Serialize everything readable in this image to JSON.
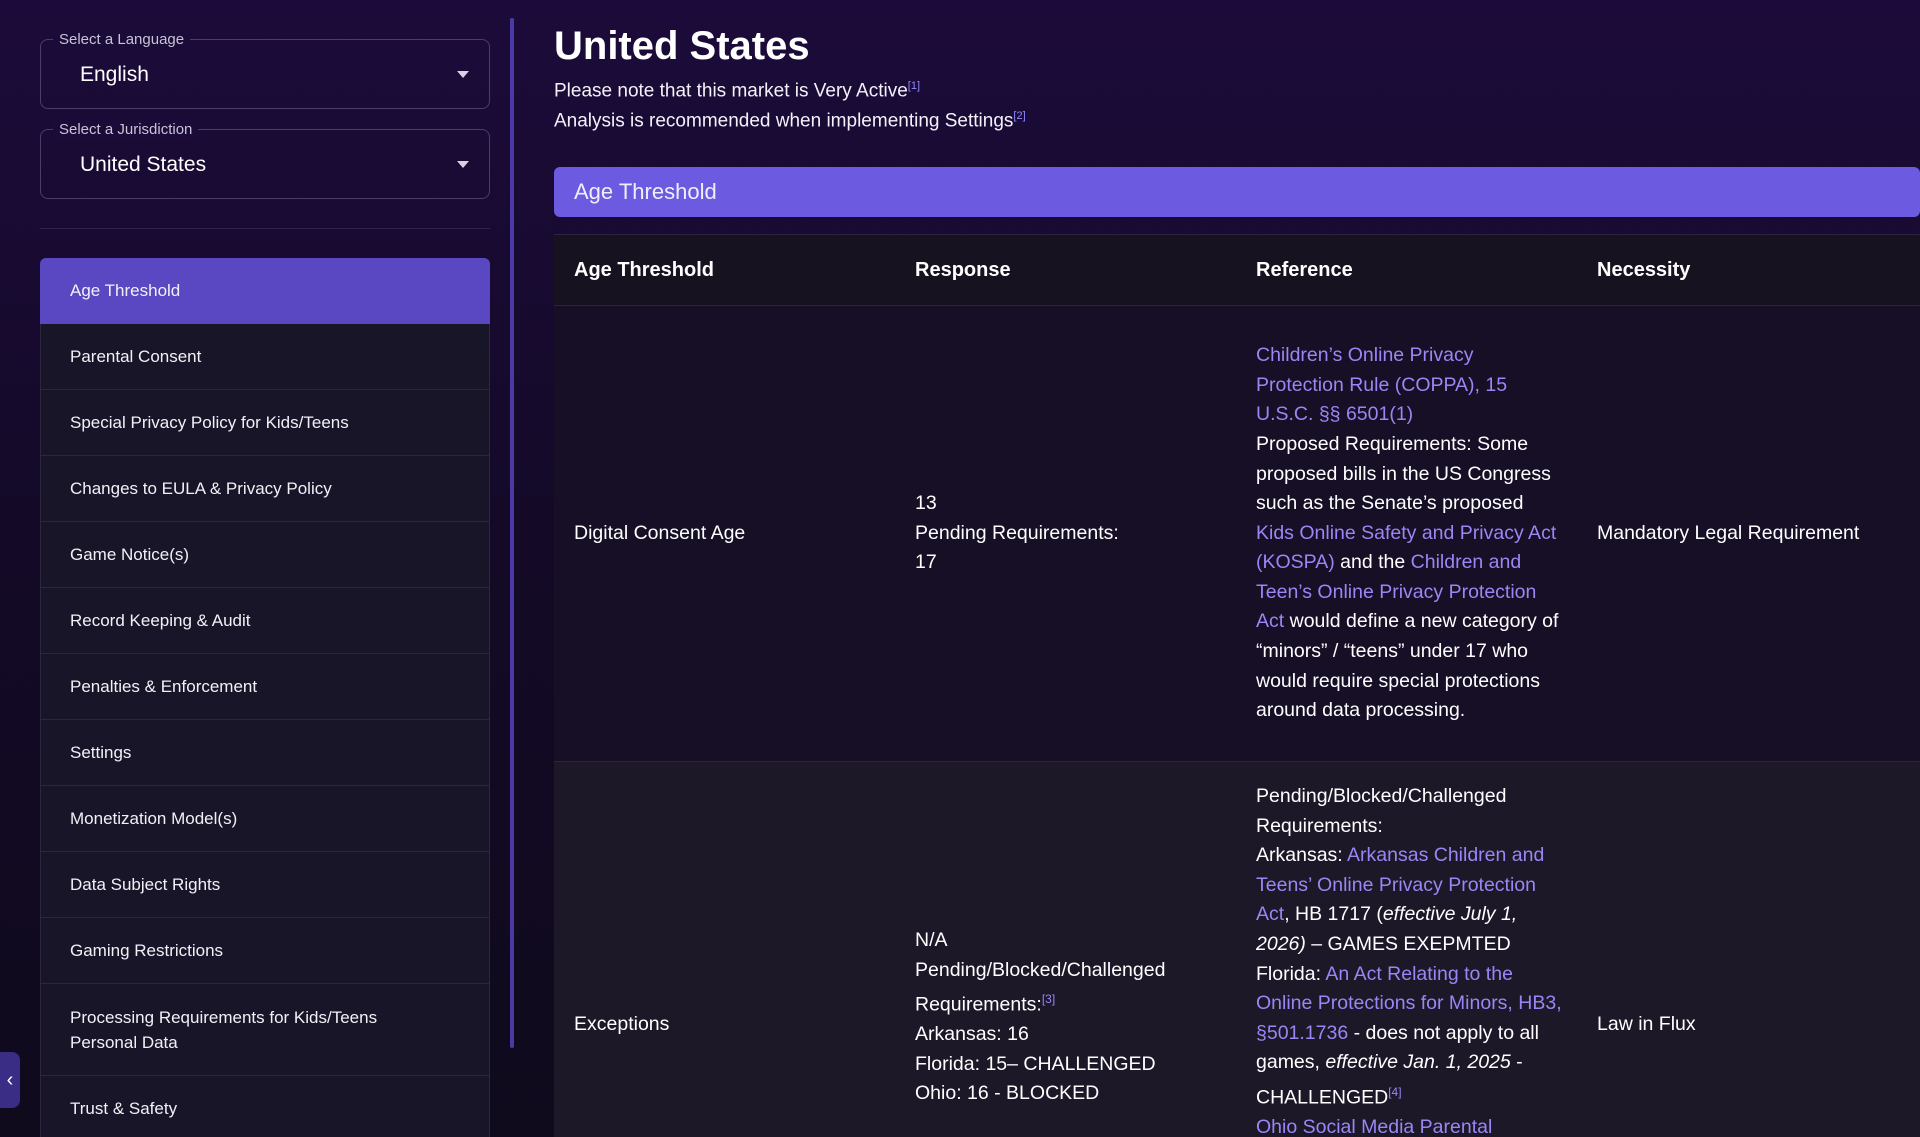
{
  "sidebar": {
    "language": {
      "legend": "Select a Language",
      "value": "English"
    },
    "jurisdiction": {
      "legend": "Select a Jurisdiction",
      "value": "United States"
    },
    "items": [
      {
        "label": "Age Threshold",
        "active": true
      },
      {
        "label": "Parental Consent"
      },
      {
        "label": "Special Privacy Policy for Kids/Teens"
      },
      {
        "label": "Changes to EULA & Privacy Policy"
      },
      {
        "label": "Game Notice(s)"
      },
      {
        "label": "Record Keeping & Audit"
      },
      {
        "label": "Penalties & Enforcement"
      },
      {
        "label": "Settings"
      },
      {
        "label": "Monetization Model(s)"
      },
      {
        "label": "Data Subject Rights"
      },
      {
        "label": "Gaming Restrictions"
      },
      {
        "label": "Processing Requirements for Kids/Teens Personal Data"
      },
      {
        "label": "Trust & Safety"
      }
    ],
    "collapse_icon": "chevron-left-icon"
  },
  "main": {
    "title": "United States",
    "note1": "Please note that this market is Very Active",
    "note1_ref": "[1]",
    "note2": "Analysis is recommended when implementing Settings",
    "note2_ref": "[2]",
    "section_title": "Age Threshold",
    "table": {
      "headers": [
        "Age Threshold",
        "Response",
        "Reference",
        "Necessity"
      ],
      "rows": [
        {
          "threshold": "Digital Consent Age",
          "response": [
            "13",
            "Pending Requirements:",
            "17"
          ],
          "reference": {
            "link1": "Children’s Online Privacy Protection Rule (COPPA), 15 U.S.C. §§ 6501(1)",
            "text1": "Proposed Requirements:",
            "text2": "Some proposed bills in the US Congress such as the Senate’s proposed",
            "link2": "Kids Online Safety and Privacy Act (KOSPA)",
            "text3": "and the",
            "link3": "Children and Teen’s Online Privacy Protection Act",
            "text4": "would define a new category of “minors” / “teens” under 17 who would require special protections around data processing."
          },
          "necessity": "Mandatory Legal Requirement"
        },
        {
          "threshold": "Exceptions",
          "response": [
            "N/A",
            "Pending/Blocked/Challenged Requirements:",
            "[3]",
            "Arkansas: 16",
            "Florida: 15– CHALLENGED",
            "Ohio: 16 - BLOCKED"
          ],
          "reference": {
            "text1": "Pending/Blocked/Challenged Requirements:",
            "ark_prefix": "Arkansas:",
            "ark_link": "Arkansas Children and Teens’ Online Privacy Protection Act",
            "ark_text": ", HB 1717 (",
            "ark_em": "effective July 1, 2026)",
            "ark_tail": " – GAMES EXEPMTED",
            "fl_prefix": "Florida:",
            "fl_link": "An Act Relating to the Online Protections for Minors, HB3, §501.1736",
            "fl_text": " - does not apply to all games, ",
            "fl_em": "effective Jan. 1, 2025",
            "fl_tail": " - CHALLENGED",
            "fl_ref": "[4]",
            "oh_link": "Ohio Social Media Parental"
          },
          "necessity": "Law in Flux"
        }
      ]
    }
  },
  "colors": {
    "accent": "#6c5ae0",
    "active_nav": "#5948c2",
    "link": "#9a86f5",
    "background": "#140a28"
  }
}
